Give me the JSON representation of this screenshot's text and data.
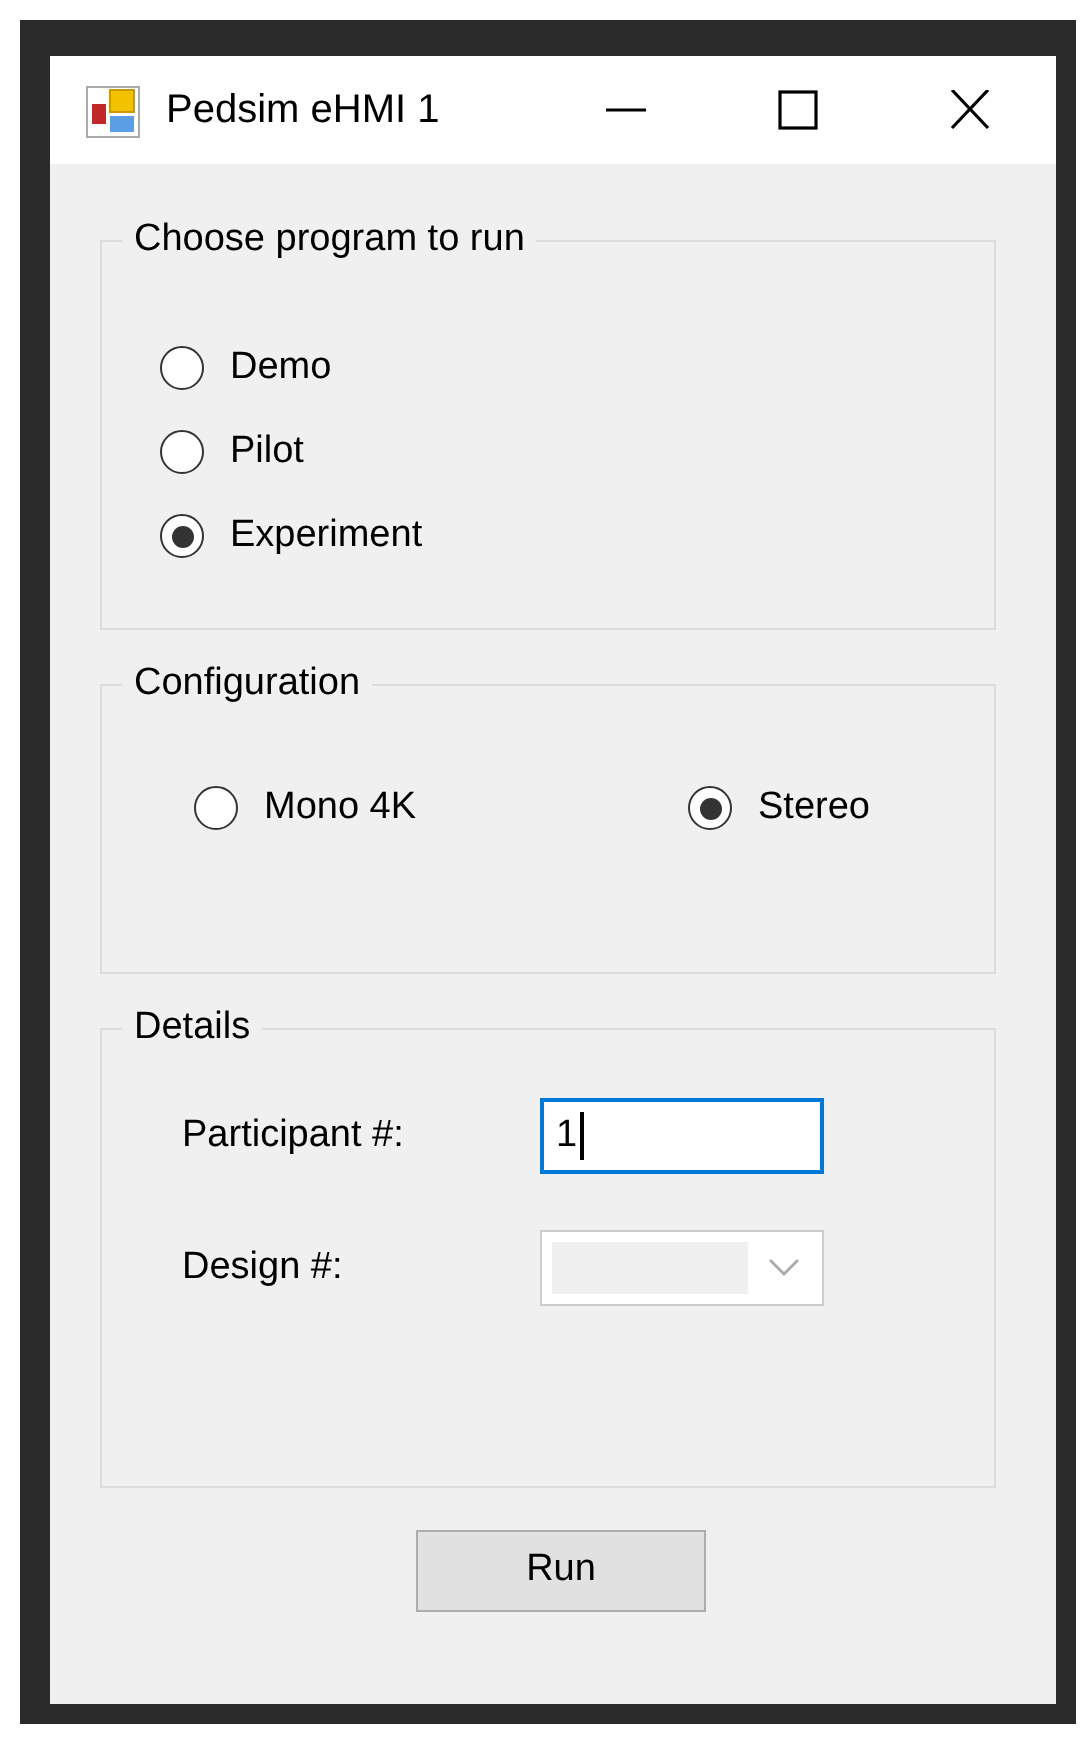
{
  "window": {
    "title": "Pedsim eHMI 1"
  },
  "groups": [
    {
      "title": "Choose program to run",
      "kind": "stack",
      "options": [
        {
          "label": "Demo",
          "selected": false
        },
        {
          "label": "Pilot",
          "selected": false
        },
        {
          "label": "Experiment",
          "selected": true
        }
      ]
    },
    {
      "title": "Configuration",
      "kind": "row",
      "options": [
        {
          "label": "Mono 4K",
          "selected": false
        },
        {
          "label": "Stereo",
          "selected": true
        }
      ]
    },
    {
      "title": "Details",
      "kind": "fields",
      "fields": [
        {
          "label": "Participant #:",
          "kind": "text",
          "value": "1",
          "focused": true
        },
        {
          "label": "Design #:",
          "kind": "combo",
          "disabled": true
        }
      ]
    }
  ],
  "run_button": "Run"
}
